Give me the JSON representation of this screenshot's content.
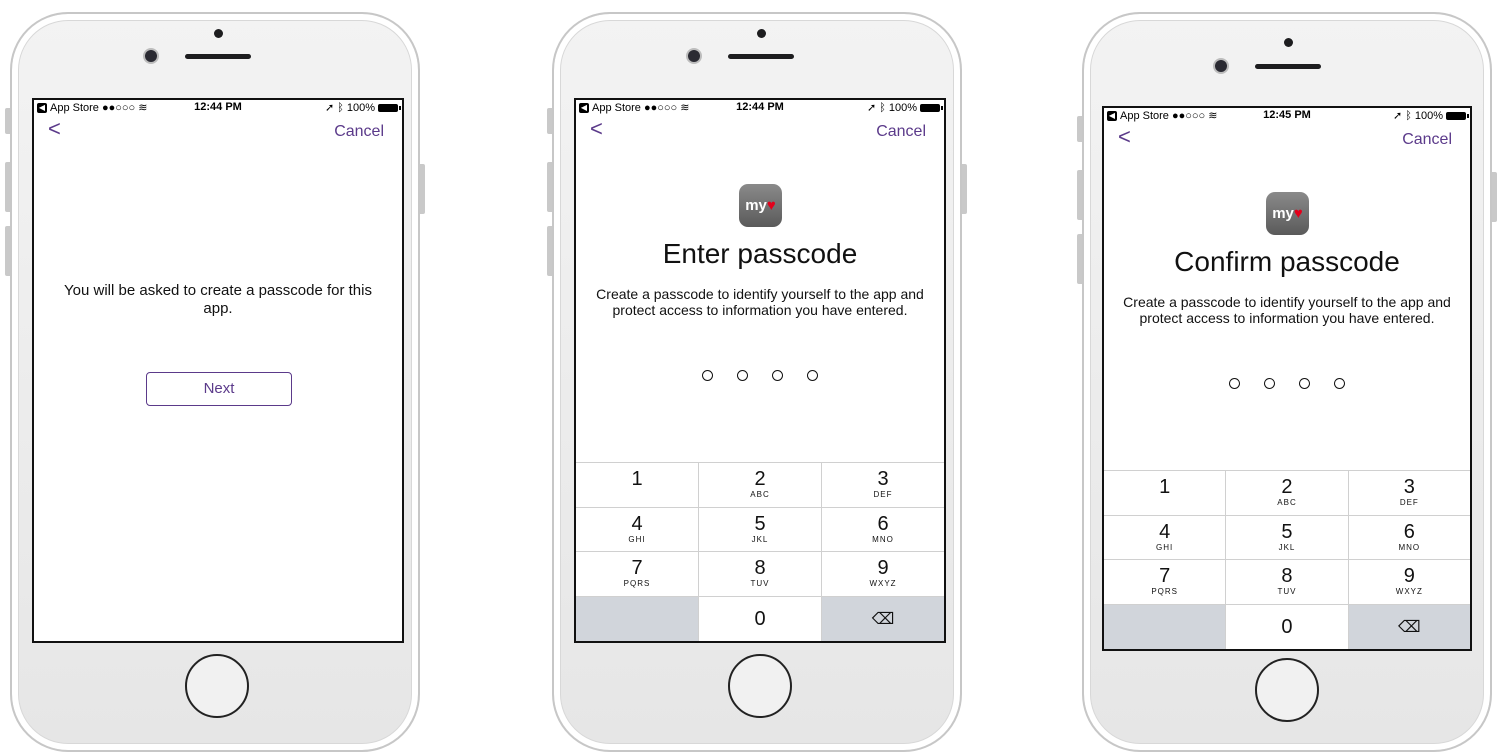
{
  "status_bar": {
    "carrier": "App Store ●●○○○",
    "battery": "100%"
  },
  "screens": [
    {
      "time": "12:44 PM",
      "back": "<",
      "cancel": "Cancel",
      "message": "You will be asked to create a passcode for this app.",
      "next_label": "Next"
    },
    {
      "time": "12:44 PM",
      "back": "<",
      "cancel": "Cancel",
      "app_icon_text": "my",
      "title": "Enter passcode",
      "description": "Create a passcode to identify yourself to the app and protect access to information you have entered."
    },
    {
      "time": "12:45 PM",
      "back": "<",
      "cancel": "Cancel",
      "app_icon_text": "my",
      "title": "Confirm passcode",
      "description": "Create a passcode to identify yourself to the app and protect access to information you have entered."
    }
  ],
  "keypad": {
    "k1": {
      "n": "1",
      "l": ""
    },
    "k2": {
      "n": "2",
      "l": "ABC"
    },
    "k3": {
      "n": "3",
      "l": "DEF"
    },
    "k4": {
      "n": "4",
      "l": "GHI"
    },
    "k5": {
      "n": "5",
      "l": "JKL"
    },
    "k6": {
      "n": "6",
      "l": "MNO"
    },
    "k7": {
      "n": "7",
      "l": "PQRS"
    },
    "k8": {
      "n": "8",
      "l": "TUV"
    },
    "k9": {
      "n": "9",
      "l": "WXYZ"
    },
    "k0": {
      "n": "0"
    },
    "delete_icon": "⌫"
  },
  "icons": [
    "back-chevron-icon",
    "wifi-icon",
    "location-arrow-icon",
    "bluetooth-icon",
    "battery-icon",
    "delete-icon"
  ],
  "colors": {
    "accent": "#5b3a8a",
    "keypad_gray": "#d1d5db"
  }
}
